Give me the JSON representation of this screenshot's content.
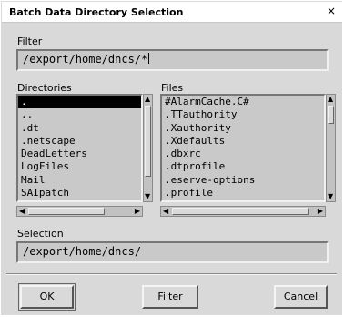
{
  "window": {
    "title": "Batch Data Directory Selection",
    "close_glyph": "×"
  },
  "filter": {
    "label": "Filter",
    "value": "/export/home/dncs/*"
  },
  "directories": {
    "label": "Directories",
    "items": [
      ".",
      "..",
      ".dt",
      ".netscape",
      "DeadLetters",
      "LogFiles",
      "Mail",
      "SAIpatch"
    ],
    "selected_index": 0
  },
  "files": {
    "label": "Files",
    "items": [
      "#AlarmCache.C#",
      ".TTauthority",
      ".Xauthority",
      ".Xdefaults",
      ".dbxrc",
      ".dtprofile",
      ".eserve-options",
      ".profile"
    ]
  },
  "selection": {
    "label": "Selection",
    "value": "/export/home/dncs/"
  },
  "buttons": {
    "ok": "OK",
    "filter": "Filter",
    "cancel": "Cancel"
  },
  "icons": {
    "close": "close-icon",
    "scroll_up": "scroll-up-arrow-icon",
    "scroll_down": "scroll-down-arrow-icon",
    "scroll_left": "scroll-left-arrow-icon",
    "scroll_right": "scroll-right-arrow-icon"
  }
}
